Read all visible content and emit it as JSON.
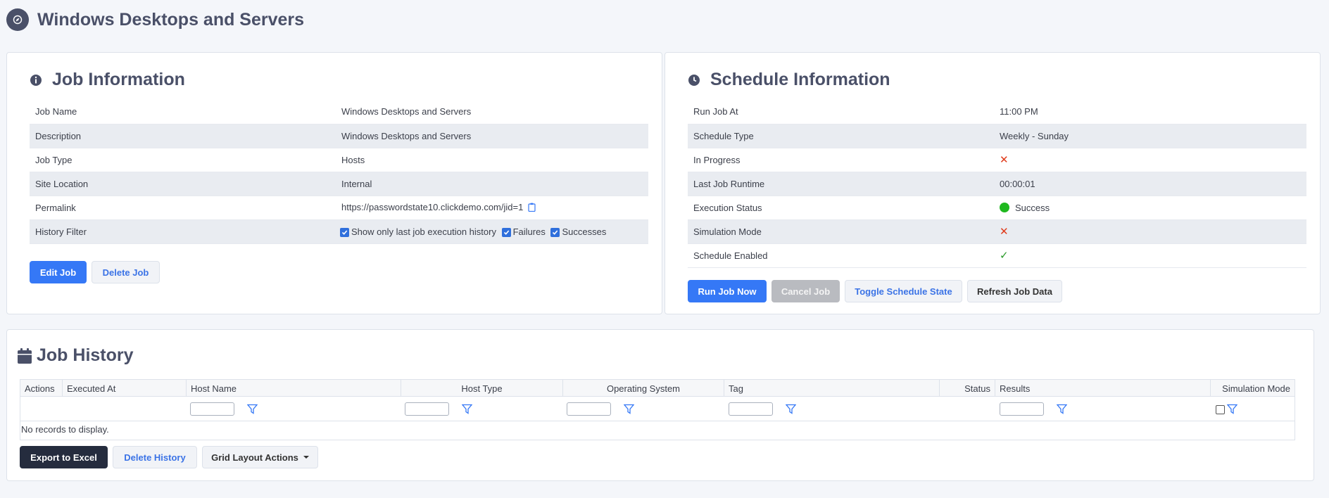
{
  "page": {
    "title": "Windows Desktops and Servers",
    "icon": "compass-icon"
  },
  "job_info": {
    "title": "Job Information",
    "rows": [
      {
        "label": "Job Name",
        "value": "Windows Desktops and Servers"
      },
      {
        "label": "Description",
        "value": "Windows Desktops and Servers"
      },
      {
        "label": "Job Type",
        "value": "Hosts"
      },
      {
        "label": "Site Location",
        "value": "Internal"
      },
      {
        "label": "Permalink",
        "value": "https://passwordstate10.clickdemo.com/jid=1"
      },
      {
        "label": "History Filter",
        "value": ""
      }
    ],
    "history_filter": {
      "last_only": "Show only last job execution history",
      "failures": "Failures",
      "successes": "Successes"
    },
    "edit_button": "Edit Job",
    "delete_button": "Delete Job"
  },
  "schedule_info": {
    "title": "Schedule Information",
    "rows": [
      {
        "label": "Run Job At",
        "value": "11:00 PM"
      },
      {
        "label": "Schedule Type",
        "value": "Weekly - Sunday"
      },
      {
        "label": "In Progress",
        "value": "✕"
      },
      {
        "label": "Last Job Runtime",
        "value": "00:00:01"
      },
      {
        "label": "Execution Status",
        "value": "Success"
      },
      {
        "label": "Simulation Mode",
        "value": "✕"
      },
      {
        "label": "Schedule Enabled",
        "value": "✓"
      }
    ],
    "buttons": {
      "run_now": "Run Job Now",
      "cancel": "Cancel Job",
      "toggle": "Toggle Schedule State",
      "refresh": "Refresh Job Data"
    },
    "colors": {
      "cross": "#e03a1a",
      "check": "#2a9a2a",
      "success": "#1fb81f"
    }
  },
  "history": {
    "title": "Job History",
    "columns": [
      "Actions",
      "Executed At",
      "Host Name",
      "Host Type",
      "Operating System",
      "Tag",
      "Status",
      "Results",
      "Simulation Mode"
    ],
    "empty_text": "No records to display.",
    "export_button": "Export to Excel",
    "delete_button": "Delete History",
    "layout_button": "Grid Layout Actions"
  },
  "colors": {
    "accent": "#3578f6",
    "heading": "#4a5068",
    "dark_button": "#252c3e"
  }
}
